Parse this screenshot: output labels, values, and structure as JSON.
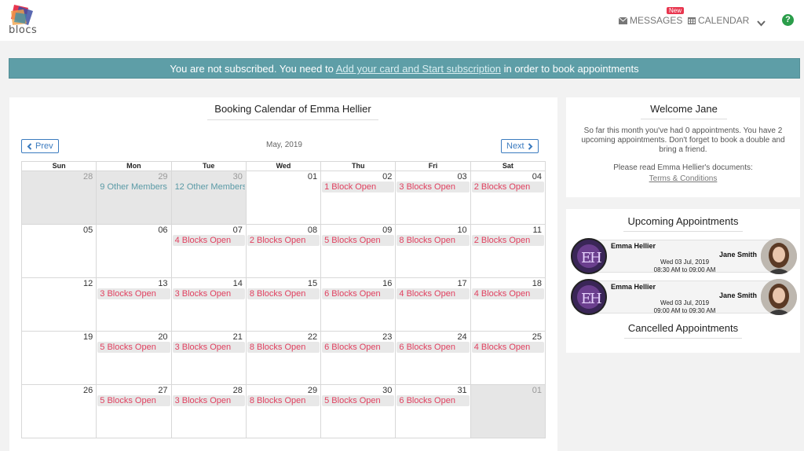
{
  "brand": {
    "name": "blocs"
  },
  "nav": {
    "messages": "MESSAGES",
    "new_badge": "New",
    "calendar": "CALENDAR",
    "help": "?"
  },
  "banner": {
    "prefix": "You are not subscribed. You need to ",
    "link": "Add your card and Start subscription",
    "suffix": " in order to book appointments"
  },
  "calendar": {
    "title": "Booking Calendar of Emma Hellier",
    "prev": "Prev",
    "next": "Next",
    "month": "May, 2019",
    "days_of_week": [
      "Sun",
      "Mon",
      "Tue",
      "Wed",
      "Thu",
      "Fri",
      "Sat"
    ],
    "weeks": [
      [
        {
          "day": "28",
          "other": true,
          "event": ""
        },
        {
          "day": "29",
          "other": true,
          "event": "9 Other Members",
          "kind": "members"
        },
        {
          "day": "30",
          "other": true,
          "event": "12 Other Members",
          "kind": "members"
        },
        {
          "day": "01",
          "other": false,
          "event": ""
        },
        {
          "day": "02",
          "other": false,
          "event": "1 Block Open"
        },
        {
          "day": "03",
          "other": false,
          "event": "3 Blocks Open"
        },
        {
          "day": "04",
          "other": false,
          "event": "2 Blocks Open"
        }
      ],
      [
        {
          "day": "05",
          "other": false,
          "event": ""
        },
        {
          "day": "06",
          "other": false,
          "event": ""
        },
        {
          "day": "07",
          "other": false,
          "event": "4 Blocks Open"
        },
        {
          "day": "08",
          "other": false,
          "event": "2 Blocks Open"
        },
        {
          "day": "09",
          "other": false,
          "event": "5 Blocks Open"
        },
        {
          "day": "10",
          "other": false,
          "event": "8 Blocks Open"
        },
        {
          "day": "11",
          "other": false,
          "event": "2 Blocks Open"
        }
      ],
      [
        {
          "day": "12",
          "other": false,
          "event": ""
        },
        {
          "day": "13",
          "other": false,
          "event": "3 Blocks Open"
        },
        {
          "day": "14",
          "other": false,
          "event": "3 Blocks Open"
        },
        {
          "day": "15",
          "other": false,
          "event": "8 Blocks Open"
        },
        {
          "day": "16",
          "other": false,
          "event": "6 Blocks Open"
        },
        {
          "day": "17",
          "other": false,
          "event": "4 Blocks Open"
        },
        {
          "day": "18",
          "other": false,
          "event": "4 Blocks Open"
        }
      ],
      [
        {
          "day": "19",
          "other": false,
          "event": ""
        },
        {
          "day": "20",
          "other": false,
          "event": "5 Blocks Open"
        },
        {
          "day": "21",
          "other": false,
          "event": "3 Blocks Open"
        },
        {
          "day": "22",
          "other": false,
          "event": "8 Blocks Open"
        },
        {
          "day": "23",
          "other": false,
          "event": "6 Blocks Open"
        },
        {
          "day": "24",
          "other": false,
          "event": "6 Blocks Open"
        },
        {
          "day": "25",
          "other": false,
          "event": "4 Blocks Open"
        }
      ],
      [
        {
          "day": "26",
          "other": false,
          "event": ""
        },
        {
          "day": "27",
          "other": false,
          "event": "5 Blocks Open"
        },
        {
          "day": "28",
          "other": false,
          "event": "3 Blocks Open"
        },
        {
          "day": "29",
          "other": false,
          "event": "8 Blocks Open"
        },
        {
          "day": "30",
          "other": false,
          "event": "5 Blocks Open"
        },
        {
          "day": "31",
          "other": false,
          "event": "6 Blocks Open"
        },
        {
          "day": "01",
          "other": true,
          "event": ""
        }
      ]
    ]
  },
  "welcome": {
    "title": "Welcome Jane",
    "text": "So far this month you've had 0 appointments. You have 2 upcoming appointments. Don't forget to book a double and bring a friend.",
    "docs_label": "Please read Emma Hellier's documents:",
    "docs_link": "Terms & Conditions"
  },
  "upcoming": {
    "title": "Upcoming Appointments",
    "appointments": [
      {
        "provider": "Emma Hellier",
        "client": "Jane Smith",
        "date": "Wed 03 Jul, 2019",
        "time": "08:30 AM to 09:00 AM"
      },
      {
        "provider": "Emma Hellier",
        "client": "Jane Smith",
        "date": "Wed 03 Jul, 2019",
        "time": "09:00 AM to 09:30 AM"
      }
    ]
  },
  "cancelled": {
    "title": "Cancelled Appointments"
  },
  "colors": {
    "banner": "#5e9ea7",
    "event_text": "#e0405f",
    "members_text": "#5a9aa6",
    "nav_button": "#3b7bbf",
    "help": "#2a9d4a",
    "badge": "#e8364f"
  }
}
